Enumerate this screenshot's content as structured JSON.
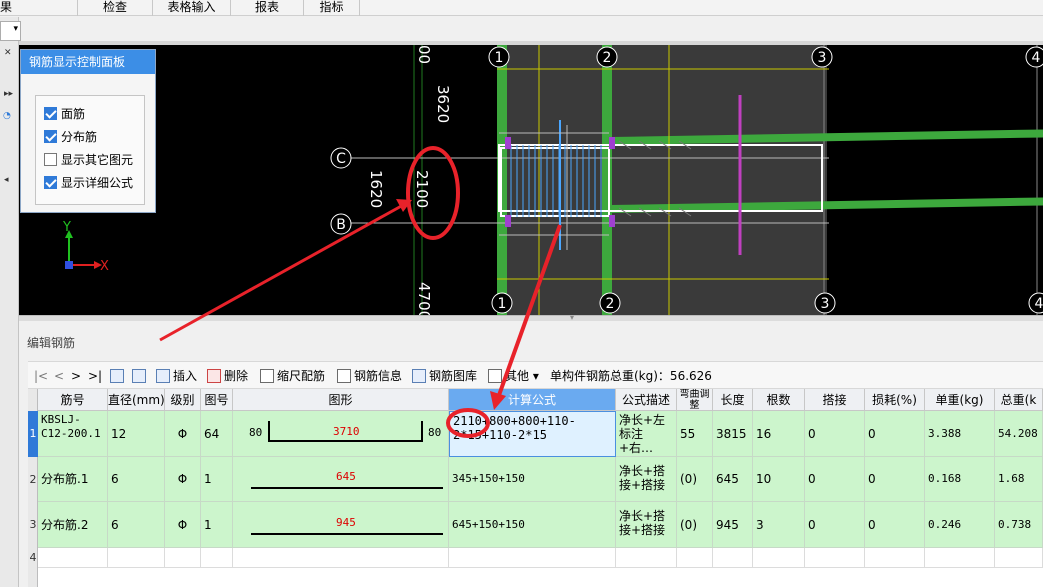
{
  "menu": {
    "items": [
      "果",
      "检查",
      "表格输入",
      "报表",
      "指标"
    ]
  },
  "canvas": {
    "axis_labels": [
      "1",
      "2",
      "3",
      "4",
      "1",
      "2",
      "3",
      "4",
      "C",
      "B"
    ],
    "dims": {
      "d3620": "3620",
      "d00": "00",
      "d2100": "2100",
      "d1620": "1620",
      "d4700": "4700"
    },
    "axis_x": "X",
    "axis_y": "Y"
  },
  "panel": {
    "title": "钢筋显示控制面板",
    "options": [
      {
        "label": "面筋",
        "checked": true
      },
      {
        "label": "分布筋",
        "checked": true
      },
      {
        "label": "显示其它图元",
        "checked": false
      },
      {
        "label": "显示详细公式",
        "checked": true
      }
    ]
  },
  "section": {
    "title": "编辑钢筋"
  },
  "toolbar": {
    "nav": [
      "|<",
      "<",
      ">",
      ">|"
    ],
    "insert": "插入",
    "delete": "删除",
    "scale": "缩尺配筋",
    "info": "钢筋信息",
    "library": "钢筋图库",
    "other": "其他",
    "total": "单构件钢筋总重(kg)：56.626"
  },
  "grid": {
    "headers": [
      "筋号",
      "直径(mm)",
      "级别",
      "图号",
      "图形",
      "计算公式",
      "公式描述",
      "弯曲调整",
      "长度",
      "根数",
      "搭接",
      "损耗(%)",
      "单重(kg)",
      "总重(k"
    ],
    "rows": [
      {
        "num": "1",
        "code": "KBSLJ-C12-200.1",
        "dia": "12",
        "grade": "Φ",
        "fig": "64",
        "shape_left": "80",
        "shape_mid": "3710",
        "shape_right": "80",
        "formula": "2110+800+800+110-2*15+110-2*15",
        "desc": "净长+左标注+右…",
        "bend": "55",
        "length": "3815",
        "count": "16",
        "lap": "0",
        "loss": "0",
        "unit_w": "3.388",
        "total_w": "54.208"
      },
      {
        "num": "2",
        "code": "分布筋.1",
        "dia": "6",
        "grade": "Φ",
        "fig": "1",
        "shape_mid": "645",
        "formula": "345+150+150",
        "desc": "净长+搭接+搭接",
        "bend": "(0)",
        "length": "645",
        "count": "10",
        "lap": "0",
        "loss": "0",
        "unit_w": "0.168",
        "total_w": "1.68"
      },
      {
        "num": "3",
        "code": "分布筋.2",
        "dia": "6",
        "grade": "Φ",
        "fig": "1",
        "shape_mid": "945",
        "formula": "645+150+150",
        "desc": "净长+搭接+搭接",
        "bend": "(0)",
        "length": "945",
        "count": "3",
        "lap": "0",
        "loss": "0",
        "unit_w": "0.246",
        "total_w": "0.738"
      }
    ],
    "empty_row_num": "4"
  },
  "colors": {
    "accent": "#3c8ee6",
    "row_green": "#ccf5cc",
    "annotation_red": "#e8222a"
  }
}
